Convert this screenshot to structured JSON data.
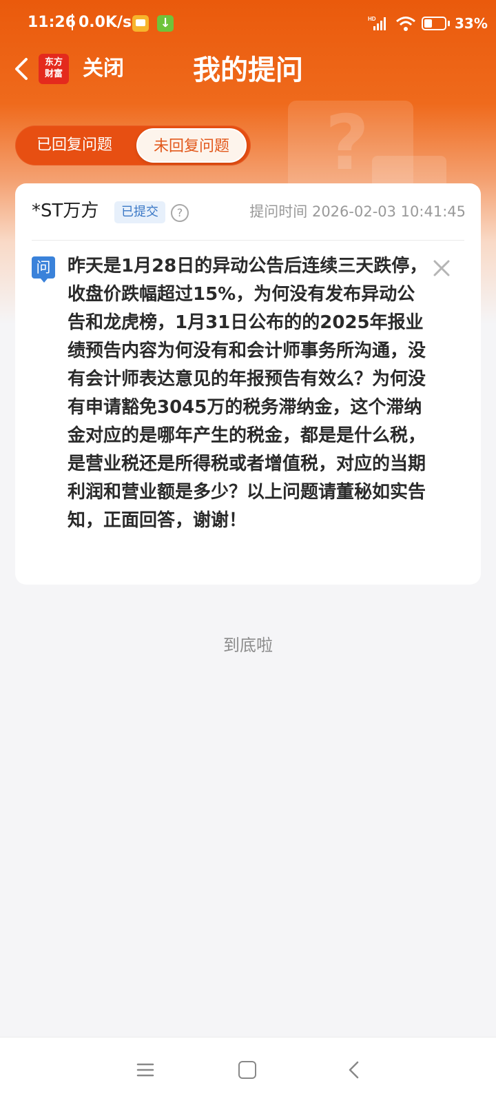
{
  "status_bar": {
    "time": "11:26",
    "net_speed": "0.0K/s",
    "battery_percent": "33%",
    "battery_level": 0.33,
    "signal_tag": "HD",
    "icons": [
      "gallery-app-icon",
      "download-app-icon",
      "signal-icon",
      "wifi-icon",
      "battery-icon"
    ]
  },
  "nav": {
    "logo_line1": "东方",
    "logo_line2": "财富",
    "close_label": "关闭",
    "title": "我的提问"
  },
  "tabs": [
    {
      "label": "已回复问题",
      "selected": false
    },
    {
      "label": "未回复问题",
      "selected": true
    }
  ],
  "question_card": {
    "stock_name": "*ST万方",
    "status_badge": "已提交",
    "help_glyph": "?",
    "ask_time": "提问时间 2026-02-03 10:41:45",
    "q_label": "问",
    "question": "昨天是1月28日的异动公告后连续三天跌停，收盘价跌幅超过15%，为何没有发布异动公告和龙虎榜，1月31日公布的的2025年报业绩预告内容为何没有和会计师事务所沟通，没有会计师表达意见的年报预告有效么？为何没有申请豁免3045万的税务滞纳金，这个滞纳金对应的是哪年产生的税金，都是是什么税，是营业税还是所得税或者增值税，对应的当期利润和营业额是多少？以上问题请董秘如实告知，正面回答，谢谢！"
  },
  "end_text": "到底啦",
  "colors": {
    "brand_orange": "#ea5a0c",
    "badge_blue": "#3b78c6",
    "logo_red": "#e42a1d"
  }
}
